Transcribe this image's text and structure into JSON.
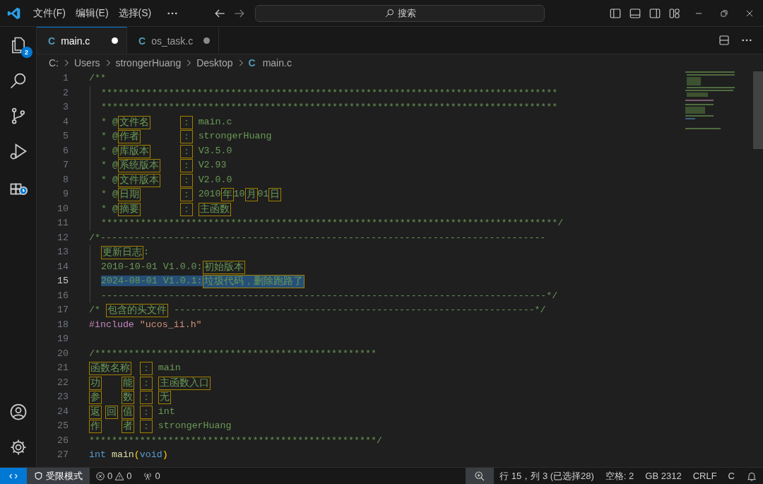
{
  "title_bar": {
    "menus": [
      "文件(F)",
      "编辑(E)",
      "选择(S)"
    ],
    "search": {
      "placeholder": "搜索"
    }
  },
  "activity_bar": {
    "explorer_badge": "2"
  },
  "tabs": [
    {
      "icon": "C",
      "label": "main.c",
      "selected": true,
      "dirty": true
    },
    {
      "icon": "C",
      "label": "os_task.c",
      "selected": false,
      "dirty": true
    }
  ],
  "breadcrumb": {
    "parts": [
      "C:",
      "Users",
      "strongerHuang",
      "Desktop"
    ],
    "file_icon": "C",
    "file": "main.c"
  },
  "editor": {
    "lines": [
      {
        "number": "1",
        "selected": false,
        "indented": false,
        "kind": "code",
        "tokens": [
          {
            "kind": "comment",
            "text": "/**"
          }
        ]
      },
      {
        "number": "2",
        "selected": false,
        "indented": true,
        "kind": "code",
        "tokens": [
          {
            "kind": "comment",
            "text": "*********************************************************************************"
          }
        ]
      },
      {
        "number": "3",
        "selected": false,
        "indented": true,
        "kind": "code",
        "tokens": [
          {
            "kind": "comment",
            "text": "*********************************************************************************"
          }
        ]
      },
      {
        "number": "4",
        "selected": false,
        "indented": true,
        "kind": "field",
        "prefix": "* @",
        "label": [
          "文件名"
        ],
        "separator": "：",
        "value": [
          {
            "kind": "comment",
            "text": "main.c"
          }
        ]
      },
      {
        "number": "5",
        "selected": false,
        "indented": true,
        "kind": "field",
        "prefix": "* @",
        "label": [
          "作者"
        ],
        "separator": "：",
        "value": [
          {
            "kind": "comment",
            "text": "strongerHuang"
          }
        ]
      },
      {
        "number": "6",
        "selected": false,
        "indented": true,
        "kind": "field",
        "prefix": "* @",
        "label": [
          "库版本"
        ],
        "separator": "：",
        "value": [
          {
            "kind": "comment",
            "text": "V3.5.0"
          }
        ]
      },
      {
        "number": "7",
        "selected": false,
        "indented": true,
        "kind": "field",
        "prefix": "* @",
        "label": [
          "系统版本"
        ],
        "separator": "：",
        "value": [
          {
            "kind": "comment",
            "text": "V2.93"
          }
        ]
      },
      {
        "number": "8",
        "selected": false,
        "indented": true,
        "kind": "field",
        "prefix": "* @",
        "label": [
          "文件版本"
        ],
        "separator": "：",
        "value": [
          {
            "kind": "comment",
            "text": "V2.0.0"
          }
        ]
      },
      {
        "number": "9",
        "selected": false,
        "indented": true,
        "kind": "field",
        "prefix": "* @",
        "label": [
          "日期"
        ],
        "separator": "：",
        "value": [
          {
            "kind": "comment",
            "text": "2010"
          },
          {
            "kind": "highlight",
            "text": "年"
          },
          {
            "kind": "comment",
            "text": "10"
          },
          {
            "kind": "highlight",
            "text": "月"
          },
          {
            "kind": "comment",
            "text": "01"
          },
          {
            "kind": "highlight",
            "text": "日"
          }
        ]
      },
      {
        "number": "10",
        "selected": false,
        "indented": true,
        "kind": "field",
        "prefix": "* @",
        "label": [
          "摘要"
        ],
        "separator": "：",
        "value": [
          {
            "kind": "highlight",
            "text": "主函数"
          }
        ]
      },
      {
        "number": "11",
        "selected": false,
        "indented": true,
        "kind": "code",
        "tokens": [
          {
            "kind": "comment",
            "text": "*********************************************************************************/"
          }
        ]
      },
      {
        "number": "12",
        "selected": false,
        "indented": false,
        "kind": "code",
        "tokens": [
          {
            "kind": "comment",
            "text": "/*-------------------------------------------------------------------------------"
          }
        ]
      },
      {
        "number": "13",
        "selected": false,
        "indented": true,
        "kind": "code",
        "tokens": [
          {
            "kind": "highlight",
            "text": "更新日志"
          },
          {
            "kind": "comment",
            "text": ":"
          }
        ]
      },
      {
        "number": "14",
        "selected": false,
        "indented": true,
        "kind": "code",
        "tokens": [
          {
            "kind": "comment",
            "text": "2010-10-01 V1.0.0:"
          },
          {
            "kind": "highlight",
            "text": "初始版本"
          }
        ]
      },
      {
        "number": "15",
        "selected": true,
        "indented": true,
        "kind": "code",
        "tokens": [
          {
            "kind": "comment",
            "text": "2024-08-01 V1.0.1:"
          },
          {
            "kind": "highlight",
            "text": "垃圾代码，删除跑路了"
          }
        ]
      },
      {
        "number": "16",
        "selected": false,
        "indented": true,
        "kind": "code",
        "tokens": [
          {
            "kind": "comment",
            "text": "-------------------------------------------------------------------------------*/"
          }
        ]
      },
      {
        "number": "17",
        "selected": false,
        "indented": false,
        "kind": "code",
        "tokens": [
          {
            "kind": "comment",
            "text": "/* "
          },
          {
            "kind": "highlight",
            "text": "包含的头文件"
          },
          {
            "kind": "comment",
            "text": " ----------------------------------------------------------------*/"
          }
        ]
      },
      {
        "number": "18",
        "selected": false,
        "indented": false,
        "kind": "code",
        "tokens": [
          {
            "kind": "preprocessor",
            "text": "#include"
          },
          {
            "kind": "string",
            "text": " \"ucos_ii.h\""
          }
        ]
      },
      {
        "number": "19",
        "selected": false,
        "kind": "code"
      },
      {
        "number": "20",
        "selected": false,
        "indented": false,
        "kind": "code",
        "tokens": [
          {
            "kind": "comment",
            "text": "/**************************************************"
          }
        ]
      },
      {
        "number": "21",
        "selected": false,
        "indented": false,
        "kind": "field",
        "label": [
          "函数名称"
        ],
        "separator": "：",
        "value": [
          {
            "kind": "comment",
            "text": "main"
          }
        ]
      },
      {
        "number": "22",
        "selected": false,
        "indented": false,
        "kind": "field",
        "label": [
          "功",
          "能"
        ],
        "separator": "：",
        "value": [
          {
            "kind": "highlight",
            "text": "主函数入口"
          }
        ]
      },
      {
        "number": "23",
        "selected": false,
        "indented": false,
        "kind": "field",
        "label": [
          "参",
          "数"
        ],
        "separator": "：",
        "value": [
          {
            "kind": "highlight",
            "text": "无"
          }
        ]
      },
      {
        "number": "24",
        "selected": false,
        "indented": false,
        "kind": "field",
        "label": [
          "返",
          "回",
          "值"
        ],
        "separator": "：",
        "value": [
          {
            "kind": "comment",
            "text": "int"
          }
        ]
      },
      {
        "number": "25",
        "selected": false,
        "indented": false,
        "kind": "field",
        "label": [
          "作",
          "者"
        ],
        "separator": "：",
        "value": [
          {
            "kind": "comment",
            "text": "strongerHuang"
          }
        ]
      },
      {
        "number": "26",
        "selected": false,
        "indented": false,
        "kind": "code",
        "tokens": [
          {
            "kind": "comment",
            "text": "***************************************************/"
          }
        ]
      },
      {
        "number": "27",
        "selected": false,
        "indented": false,
        "kind": "code",
        "tokens": [
          {
            "kind": "keyword",
            "text": "int"
          },
          {
            "kind": "function",
            "text": " main"
          },
          {
            "kind": "bracket",
            "text": "("
          },
          {
            "kind": "keyword",
            "text": "void"
          },
          {
            "kind": "bracket",
            "text": ")"
          }
        ]
      }
    ]
  },
  "status_bar": {
    "restricted_mode": "受限模式",
    "errors": "0",
    "warnings": "0",
    "ports": "0",
    "position": "行 15，列 3 (已选择28)",
    "indentation": "空格: 2",
    "encoding": "GB 2312",
    "line_ending": "CRLF",
    "language": "C"
  }
}
